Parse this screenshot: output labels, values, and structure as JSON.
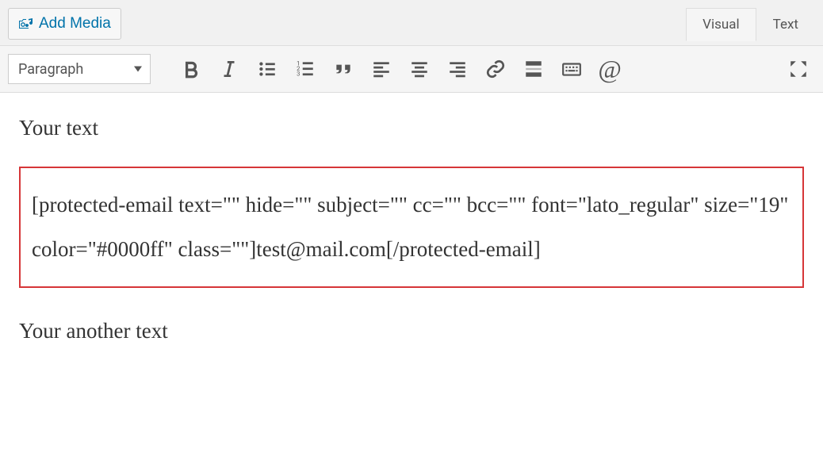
{
  "top": {
    "add_media_label": "Add Media"
  },
  "tabs": {
    "visual": "Visual",
    "text": "Text"
  },
  "toolbar": {
    "format_selected": "Paragraph"
  },
  "content": {
    "line1": "Your text",
    "shortcode": "[protected-email text=\"\" hide=\"\" subject=\"\" cc=\"\" bcc=\"\" font=\"lato_regular\" size=\"19\" color=\"#0000ff\" class=\"\"]test@mail.com[/protected-email]",
    "line2": "Your another text"
  }
}
